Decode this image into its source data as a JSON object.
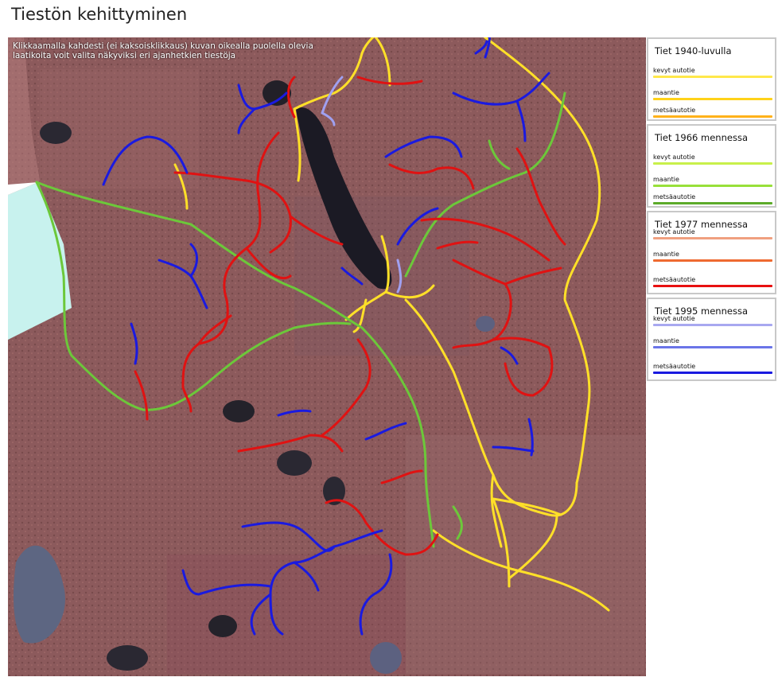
{
  "page": {
    "title": "Tiestön kehittyminen"
  },
  "map": {
    "instructions_line1": "Klikkaamalla kahdesti (ei kaksoisklikkaus) kuvan oikealla puolella olevia",
    "instructions_line2": "laatikoita voit valita näkyviksi eri ajanhetkien tiestöja"
  },
  "legend": [
    {
      "title": "Tiet 1940-luvulla",
      "items": [
        {
          "label": "kevyt autotie",
          "color": "#ffe84a"
        },
        {
          "label": "maantie",
          "color": "#ffd21a"
        },
        {
          "label": "metsäautotie",
          "color": "#ffb21a"
        }
      ]
    },
    {
      "title": "Tiet 1966 mennessa",
      "items": [
        {
          "label": "kevyt autotie",
          "color": "#c8f04a"
        },
        {
          "label": "maantie",
          "color": "#98e03a"
        },
        {
          "label": "metsäautotie",
          "color": "#5cab2a"
        }
      ]
    },
    {
      "title": "Tiet 1977 mennessa",
      "items": [
        {
          "label": "kevyt autotie",
          "color": "#f0a080"
        },
        {
          "label": "maantie",
          "color": "#ee6a30"
        },
        {
          "label": "metsäautotie",
          "color": "#e81010"
        }
      ]
    },
    {
      "title": "Tiet 1995 mennessa",
      "items": [
        {
          "label": "kevyt autotie",
          "color": "#a8a8f0"
        },
        {
          "label": "maantie",
          "color": "#6a74e8"
        },
        {
          "label": "metsäautotie",
          "color": "#1a1ae0"
        }
      ]
    }
  ]
}
